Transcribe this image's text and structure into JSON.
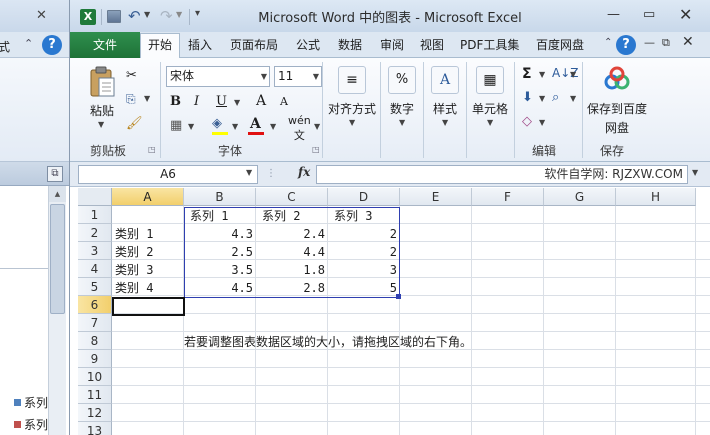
{
  "word_window": {
    "tab_fragment": "式",
    "legend_items": [
      {
        "label": "系列",
        "color": "#4f81bd"
      },
      {
        "label": "系列",
        "color": "#c0504d"
      }
    ]
  },
  "excel_window": {
    "title": "Microsoft Word 中的图表 - Microsoft Excel",
    "file_tab": "文件",
    "tabs": [
      "开始",
      "插入",
      "页面布局",
      "公式",
      "数据",
      "审阅",
      "视图",
      "PDF工具集",
      "百度网盘"
    ],
    "active_tab": "开始"
  },
  "ribbon": {
    "clipboard": {
      "group_label": "剪贴板",
      "paste_label": "粘贴"
    },
    "font": {
      "group_label": "字体",
      "font_name": "宋体",
      "font_size": "11",
      "bold": "B",
      "italic": "I",
      "underline": "U",
      "grow": "A",
      "shrink": "A",
      "font_color_glyph": "A",
      "phonetic": "wén",
      "fill_color": "#ffff00",
      "font_color": "#e01010"
    },
    "alignment": {
      "label": "对齐方式",
      "icon": "≡"
    },
    "number": {
      "label": "数字",
      "icon": "%"
    },
    "styles": {
      "label": "样式",
      "icon": "A"
    },
    "cells": {
      "label": "单元格",
      "icon": "▦"
    },
    "editing": {
      "group_label": "编辑",
      "sum_glyph": "Σ"
    },
    "save": {
      "group_label": "保存",
      "button_label": "保存到百度网盘"
    }
  },
  "formula_bar": {
    "name_box": "A6",
    "fx": "fx",
    "content": "软件自学网: RJZXW.COM"
  },
  "sheet": {
    "columns": [
      "A",
      "B",
      "C",
      "D",
      "E",
      "F",
      "G",
      "H"
    ],
    "active_column": "A",
    "rows": [
      "1",
      "2",
      "3",
      "4",
      "5",
      "6",
      "7",
      "8",
      "9",
      "10",
      "11",
      "12",
      "13"
    ],
    "active_row": "6",
    "series_headers": [
      "系列 1",
      "系列 2",
      "系列 3"
    ],
    "data_rows": [
      {
        "category": "类别 1",
        "values": [
          "4.3",
          "2.4",
          "2"
        ]
      },
      {
        "category": "类别 2",
        "values": [
          "2.5",
          "4.4",
          "2"
        ]
      },
      {
        "category": "类别 3",
        "values": [
          "3.5",
          "1.8",
          "3"
        ]
      },
      {
        "category": "类别 4",
        "values": [
          "4.5",
          "2.8",
          "5"
        ]
      }
    ],
    "note": "若要调整图表数据区域的大小，请拖拽区域的右下角。"
  }
}
